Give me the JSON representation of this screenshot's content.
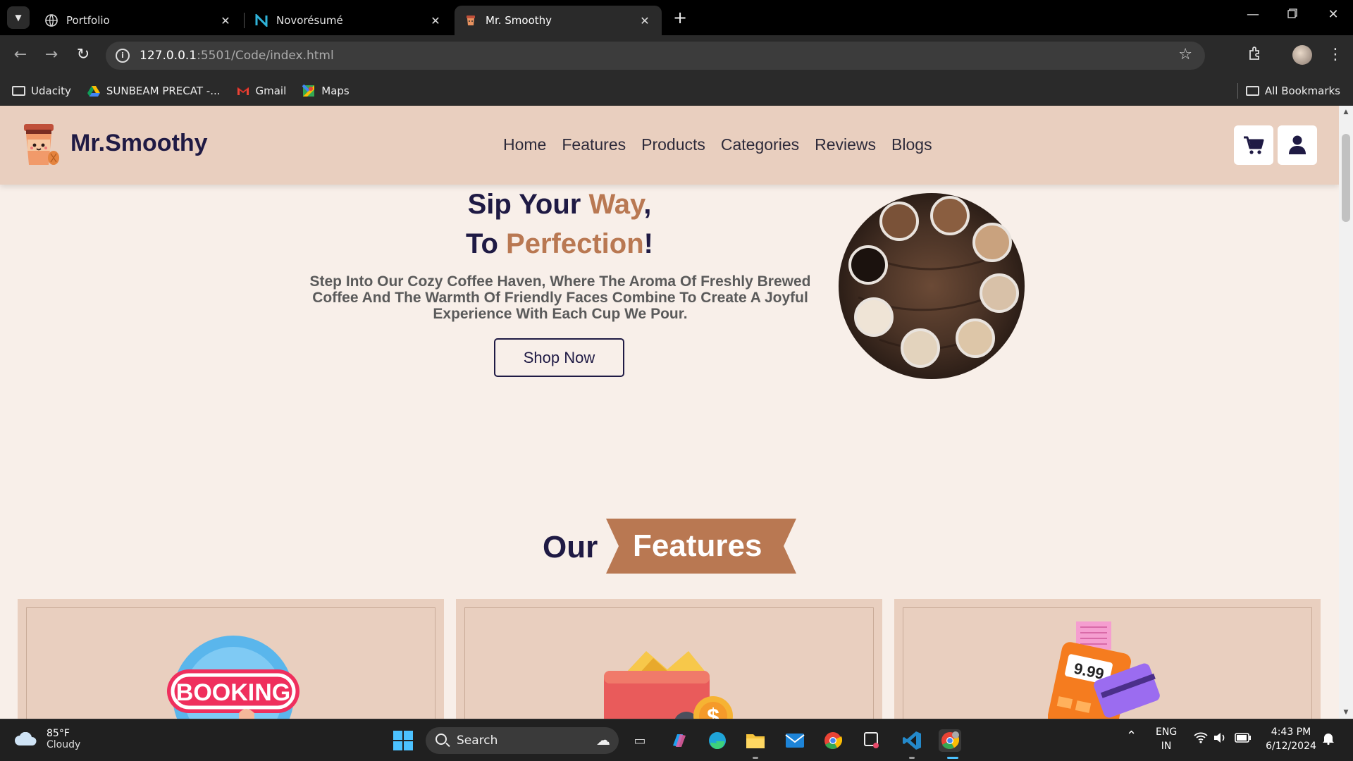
{
  "browser": {
    "tabs": [
      {
        "label": "Portfolio",
        "icon": "globe-icon",
        "active": false
      },
      {
        "label": "Novorésumé",
        "icon": "novoresume-icon",
        "active": false
      },
      {
        "label": "Mr. Smoothy",
        "icon": "mr-smoothy-favicon",
        "active": true
      }
    ],
    "close_glyph": "✕",
    "new_tab_glyph": "+",
    "url_host": "127.0.0.1",
    "url_rest": ":5501/Code/index.html",
    "bookmarks": [
      {
        "label": "Udacity",
        "icon": "folder-icon"
      },
      {
        "label": "SUNBEAM PRECAT -...",
        "icon": "google-drive-icon"
      },
      {
        "label": "Gmail",
        "icon": "gmail-icon"
      },
      {
        "label": "Maps",
        "icon": "google-maps-icon"
      }
    ],
    "all_bookmarks": "All Bookmarks"
  },
  "site": {
    "brand": "Mr.Smoothy",
    "nav": [
      "Home",
      "Features",
      "Products",
      "Categories",
      "Reviews",
      "Blogs"
    ],
    "hero": {
      "line1_a": "Sip Your ",
      "line1_b": "Way",
      "line1_c": ",",
      "line2_a": "To ",
      "line2_b": "Perfection",
      "line2_c": "!",
      "description": "Step Into Our Cozy Coffee Haven, Where The Aroma Of Freshly Brewed Coffee And The Warmth Of Friendly Faces Combine To Create A Joyful Experience With Each Cup We Pour.",
      "cta": "Shop Now"
    },
    "features": {
      "heading_a": "Our",
      "heading_b": "Features",
      "cards": [
        {
          "art": "booking-icon",
          "art_text": "BOOKING"
        },
        {
          "art": "wallet-icon"
        },
        {
          "art": "payment-terminal-icon",
          "art_text": "9.99"
        }
      ]
    },
    "colors": {
      "accent": "#b97852",
      "navy": "#1f1a44",
      "header_bg": "#e9cfbf",
      "page_bg": "#f8efe9"
    }
  },
  "taskbar": {
    "temperature": "85°F",
    "condition": "Cloudy",
    "search_label": "Search",
    "lang_1": "ENG",
    "lang_2": "IN",
    "time": "4:43 PM",
    "date": "6/12/2024"
  }
}
